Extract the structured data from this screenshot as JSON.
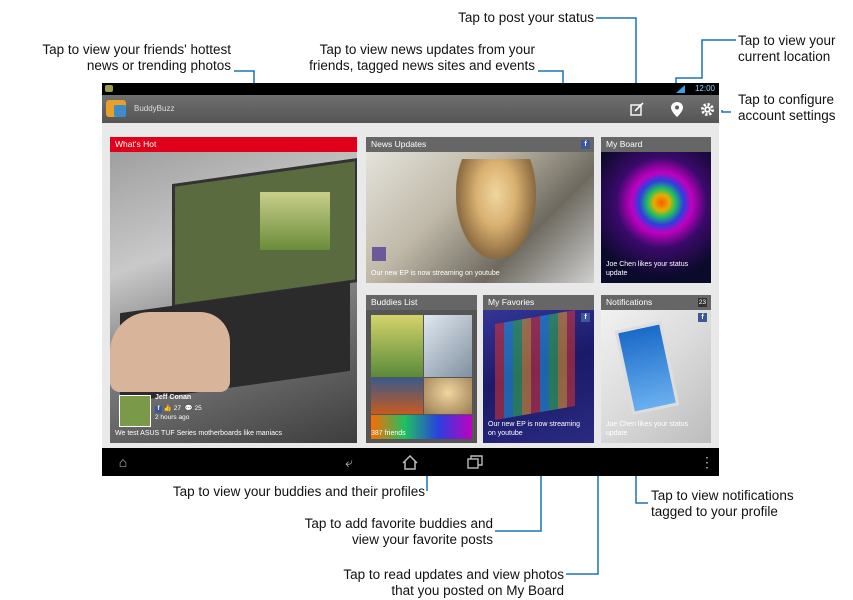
{
  "callouts": {
    "whats_hot": [
      "Tap to view your friends' hottest",
      "news or trending photos"
    ],
    "news_updates": [
      "Tap to view news updates from your",
      "friends, tagged news sites and events"
    ],
    "post_status": [
      "Tap to post your status"
    ],
    "location": [
      "Tap to view your",
      "current location"
    ],
    "settings": [
      "Tap to configure",
      "account settings"
    ],
    "buddies": [
      "Tap to view your buddies and their profiles"
    ],
    "favorites": [
      "Tap to add favorite buddies and",
      "view your favorite posts"
    ],
    "my_board": [
      "Tap to read updates and view photos",
      "that you posted on My Board"
    ],
    "notifications": [
      "Tap to view notifications",
      "tagged to your profile"
    ]
  },
  "screen": {
    "status_time": "12:00",
    "app_title": "BuddyBuzz",
    "icons": {
      "post": "compose-icon",
      "location": "location-pin-icon",
      "settings": "gear-icon"
    },
    "tiles": {
      "whats_hot": {
        "title": "What's Hot",
        "user": "Jeff Conan",
        "likes": "27",
        "comments": "25",
        "time": "2 hours ago",
        "caption": "We test ASUS TUF Series motherboards like maniacs"
      },
      "news_updates": {
        "title": "News Updates",
        "caption": "Our new EP is now streaming on youtube"
      },
      "my_board": {
        "title": "My Board",
        "caption": "Joe Chen likes your status update"
      },
      "buddies_list": {
        "title": "Buddies List",
        "count": "387 friends"
      },
      "my_favorites": {
        "title": "My Favories",
        "caption": "Our new EP is now streaming on youtube"
      },
      "notifications": {
        "title": "Notifications",
        "badge": "23",
        "caption": "Joe Chen likes your status update"
      }
    },
    "nav": {
      "back": "back-icon",
      "home": "home-icon",
      "recent": "recent-apps-icon"
    }
  },
  "colors": {
    "accent_red": "#e0001a",
    "leader_blue": "#1a73b8",
    "action_bar": "#5f5f5f"
  }
}
